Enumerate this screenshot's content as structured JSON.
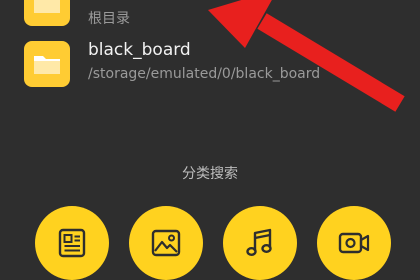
{
  "folders": [
    {
      "name": "",
      "path": "根目录"
    },
    {
      "name": "black_board",
      "path": "/storage/emulated/0/black_board"
    }
  ],
  "category_search": {
    "title": "分类搜索",
    "buttons": [
      {
        "icon": "document-icon"
      },
      {
        "icon": "image-icon"
      },
      {
        "icon": "music-icon"
      },
      {
        "icon": "video-icon"
      }
    ]
  },
  "colors": {
    "background": "#2e2e2e",
    "folder_yellow": "#ffcc33",
    "category_yellow": "#ffd21f",
    "annotation_red": "#e8201e"
  }
}
